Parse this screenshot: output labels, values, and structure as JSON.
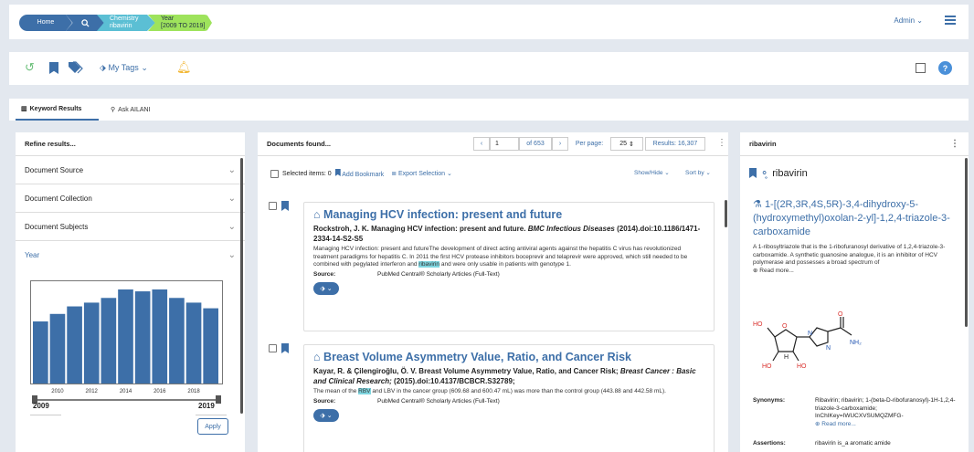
{
  "breadcrumb": {
    "home": "Home",
    "chemistry_label": "Chemistry",
    "chemistry_value": "ribavirin",
    "year_label": "Year",
    "year_value": "[2009 TO 2019]"
  },
  "header": {
    "admin": "Admin"
  },
  "toolbar": {
    "my_tags": "My Tags"
  },
  "tabs": [
    {
      "label": "Keyword Results"
    },
    {
      "label": "Ask AILANI"
    }
  ],
  "refine": {
    "title": "Refine results...",
    "sections": [
      {
        "label": "Document Source"
      },
      {
        "label": "Document Collection"
      },
      {
        "label": "Document Subjects"
      },
      {
        "label": "Year"
      }
    ],
    "from": "2009",
    "to": "2019",
    "apply": "Apply"
  },
  "chart_data": {
    "type": "bar",
    "title": "",
    "xlabel": "",
    "ylabel": "",
    "categories": [
      "2009",
      "2010",
      "2011",
      "2012",
      "2013",
      "2014",
      "2015",
      "2016",
      "2017",
      "2018",
      "2019"
    ],
    "values": [
      66,
      74,
      82,
      86,
      91,
      100,
      98,
      100,
      91,
      86,
      80
    ],
    "xticks": [
      "2010",
      "2012",
      "2014",
      "2016",
      "2018"
    ],
    "ylim": [
      0,
      100
    ],
    "bar_color": "#3d6fa8"
  },
  "documents": {
    "title": "Documents found...",
    "page": "1",
    "of_pages": "of 653",
    "per_page_label": "Per page:",
    "per_page": "25",
    "results": "Results: 16,307",
    "selected": "Selected items: 0",
    "add_bookmark": "Add Bookmark",
    "export": "Export Selection",
    "show_hide": "Show/Hide",
    "sort_by": "Sort by",
    "source_label": "Source:",
    "items": [
      {
        "title": "Managing HCV infection: present and future",
        "ref_a": "Rockstroh, J. K. Managing HCV infection: present and future.",
        "ref_journal": "BMC Infectious Diseases",
        "ref_b": "(2014).doi:10.1186/1471-2334-14-S2-S5",
        "abs_a": "Managing HCV infection: present and futureThe development of direct acting antiviral agents against the hepatitis C virus has revolutionized treatment paradigms for hepatitis C. In 2011 the first HCV protease inhibitors boceprevir and telaprevir were approved, which still needed to be combined with pegylated interferon and",
        "abs_hl": "ribavirin",
        "abs_b": "and were only usable in patients with genotype 1.",
        "source": "PubMed Central® Scholarly Articles (Full-Text)"
      },
      {
        "title": "Breast Volume Asymmetry Value, Ratio, and Cancer Risk",
        "ref_a": "Kayar, R. & Çilengiroğlu, Ö. V. Breast Volume Asymmetry Value, Ratio, and Cancer Risk;",
        "ref_journal": "Breast Cancer : Basic and Clinical Research;",
        "ref_b": "(2015).doi:10.4137/BCBCR.S32789;",
        "abs_a": "The mean of the",
        "abs_hl": "RBV",
        "abs_b": "and LBV in the cancer group (609.68 and 600.47 mL) was more than the control group (443.88 and 442.58 mL).",
        "source": "PubMed Central® Scholarly Articles (Full-Text)"
      }
    ]
  },
  "entity": {
    "header": "ribavirin",
    "name": "ribavirin",
    "iupac": "1-[(2R,3R,4S,5R)-3,4-dihydroxy-5-(hydroxymethyl)oxolan-2-yl]-1,2,4-triazole-3-carboxamide",
    "description": "A 1-ribosyltriazole that is the 1-ribofuranosyl derivative of 1,2,4-triazole-3-carboxamide. A synthetic guanosine analogue, it is an inhibitor of HCV polymerase and possesses a broad spectrum of",
    "read_more": "Read more...",
    "synonyms_label": "Synonyms:",
    "synonyms": "Ribavirin; ribavirin; 1-(beta-D-ribofuranosyl)-1H-1,2,4-triazole-3-carboxamide; InChIKey=IWUCXVSUMQZMFG-",
    "read_more2": "Read more...",
    "assertions_label": "Assertions:",
    "assertions": "ribavirin is_a aromatic amide",
    "struct_labels": {
      "ho": "HO",
      "h": "H",
      "nh2": "NH₂",
      "o": "O",
      "n": "N"
    }
  }
}
